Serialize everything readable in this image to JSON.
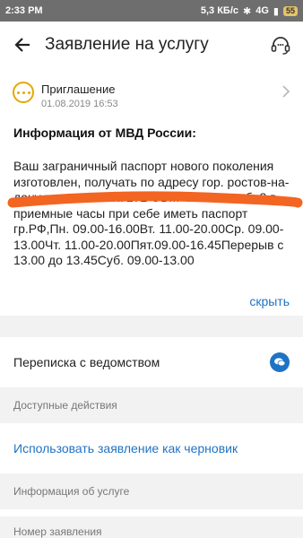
{
  "status_bar": {
    "time": "2:33 PM",
    "network": "5,3 КБ/с",
    "signal": "4G",
    "battery": "55"
  },
  "header": {
    "title": "Заявление на услугу"
  },
  "notification": {
    "title": "Приглашение",
    "date": "01.08.2019 16:53"
  },
  "message": {
    "heading": "Информация от МВД России:",
    "body": "Ваш заграничный паспорт нового поколения изготовлен, получать по адресу гор. ростов-на-дону пр. шолохова 272 ОВМ ОП№6 . каб. 8 в приемные часы при себе иметь паспорт гр.РФ,Пн. 09.00-16.00Вт. 11.00-20.00Ср. 09.00-13.00Чт. 11.00-20.00Пят.09.00-16.45Перерыв с 13.00 до 13.45Суб. 09.00-13.00",
    "hide_label": "скрыть"
  },
  "correspondence": {
    "label": "Переписка с ведомством"
  },
  "actions": {
    "section_label": "Доступные действия",
    "use_as_draft": "Использовать заявление как черновик"
  },
  "service_info": {
    "section_label": "Информация об услуге",
    "application_number_label": "Номер заявления"
  },
  "colors": {
    "accent": "#1f73c4",
    "notice": "#e3a800",
    "redaction": "#f26522"
  }
}
